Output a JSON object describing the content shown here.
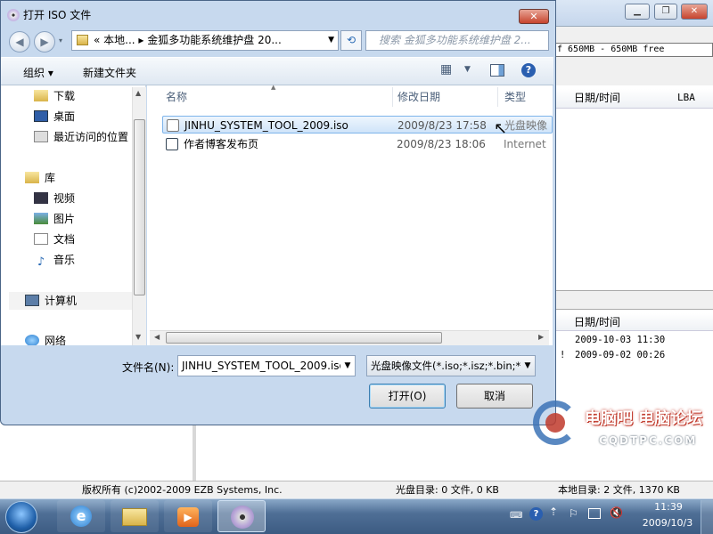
{
  "background_app": {
    "free_space": "f 650MB - 650MB free",
    "top_headers": {
      "datetime": "日期/时间",
      "lba": "LBA"
    },
    "lower_headers": {
      "datetime": "日期/时间"
    },
    "lower_rows": [
      {
        "flag": "",
        "datetime": "2009-10-03 11:30"
      },
      {
        "flag": "!",
        "datetime": "2009-09-02 00:26"
      }
    ],
    "status": {
      "copyright": "版权所有 (c)2002-2009 EZB Systems, Inc.",
      "disc_dir": "光盘目录: 0 文件, 0 KB",
      "local_dir": "本地目录: 2 文件, 1370 KB"
    }
  },
  "dialog": {
    "title": "打开 ISO 文件",
    "close_glyph": "✕",
    "address": "« 本地... ▸ 金狐多功能系统维护盘 20...",
    "search_placeholder": "搜索 金狐多功能系统维护盘 2...",
    "toolbar": {
      "organize": "组织 ▾",
      "new_folder": "新建文件夹"
    },
    "nav": {
      "favorites": [
        {
          "label": "下载",
          "icon": "download-folder-icon"
        },
        {
          "label": "桌面",
          "icon": "desktop-icon"
        },
        {
          "label": "最近访问的位置",
          "icon": "recent-places-icon"
        }
      ],
      "library": {
        "label": "库",
        "items": [
          "视频",
          "图片",
          "文档",
          "音乐"
        ]
      },
      "computer": "计算机",
      "network": "网络"
    },
    "columns": {
      "name": "名称",
      "modified": "修改日期",
      "type": "类型"
    },
    "files": [
      {
        "name": "JINHU_SYSTEM_TOOL_2009.iso",
        "modified": "2009/8/23 17:58",
        "type": "光盘映像"
      },
      {
        "name": "作者博客发布页",
        "modified": "2009/8/23 18:06",
        "type": "Internet"
      }
    ],
    "filename_label": "文件名(N):",
    "filename_value": "JINHU_SYSTEM_TOOL_2009.iso",
    "filetype_value": "光盘映像文件(*.iso;*.isz;*.bin;*",
    "open_button": "打开(O)",
    "cancel_button": "取消"
  },
  "watermark": {
    "line1": "电脑吧 电脑论坛",
    "line2": "CQDTPC.COM"
  },
  "taskbar": {
    "time": "11:39",
    "date": "2009/10/3"
  }
}
